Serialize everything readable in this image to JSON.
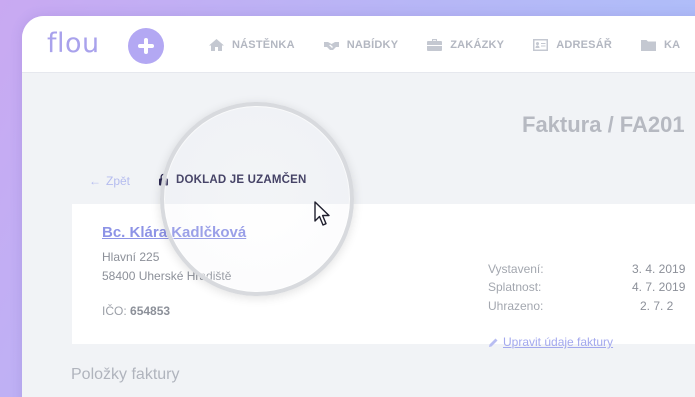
{
  "app": {
    "logo": "flou"
  },
  "nav": [
    {
      "label": "NÁSTĚNKA",
      "icon": "home-icon"
    },
    {
      "label": "NABÍDKY",
      "icon": "handshake-icon"
    },
    {
      "label": "ZAKÁZKY",
      "icon": "briefcase-icon"
    },
    {
      "label": "ADRESÁŘ",
      "icon": "contact-card-icon"
    },
    {
      "label": "KA",
      "icon": "folder-icon"
    }
  ],
  "document": {
    "title": "Faktura / FA201",
    "back_label": "Zpět",
    "lock_status": "DOKLAD JE UZAMČEN"
  },
  "client": {
    "name": "Bc. Klára Kadlčková",
    "street": "Hlavní 225",
    "city": "58400 Uherské Hradiště",
    "ico_label": "IČO:",
    "ico_value": "654853"
  },
  "invoice_meta": [
    {
      "label": "Vystavení:",
      "value": "3. 4. 2019"
    },
    {
      "label": "Splatnost:",
      "value": "4. 7. 2019"
    },
    {
      "label": "Uhrazeno:",
      "value": "2. 7. 2"
    }
  ],
  "edit_link": "Upravit údaje faktury",
  "items_section": {
    "title": "Položky faktury"
  }
}
